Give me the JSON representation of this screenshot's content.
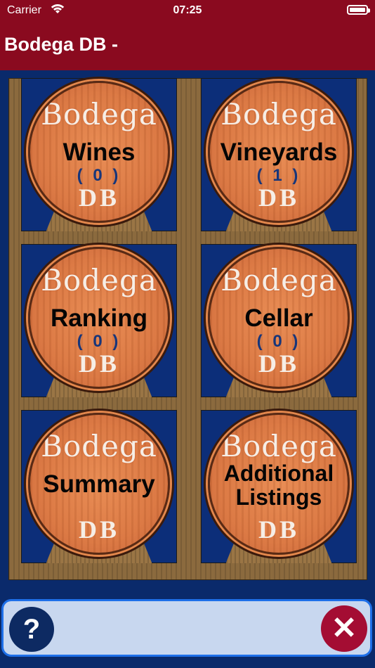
{
  "status_bar": {
    "carrier": "Carrier",
    "time": "07:25",
    "wifi_icon": "wifi-icon",
    "battery_icon": "battery-icon"
  },
  "nav": {
    "title": "Bodega DB -"
  },
  "barrel_branding": {
    "top_text": "Bodega",
    "bottom_text": "DB"
  },
  "tiles": [
    {
      "label": "Wines",
      "count": "( 0 )"
    },
    {
      "label": "Vineyards",
      "count": "( 1 )"
    },
    {
      "label": "Ranking",
      "count": "( 0 )"
    },
    {
      "label": "Cellar",
      "count": "( 0 )"
    },
    {
      "label": "Summary",
      "count": ""
    },
    {
      "label": "Additional Listings",
      "count": ""
    }
  ],
  "toolbar": {
    "help_label": "?",
    "help_icon": "help-icon",
    "close_label": "✕",
    "close_icon": "close-icon"
  },
  "colors": {
    "header": "#8a0a1f",
    "background": "#0a2a6b",
    "toolbar": "#c8d7ef",
    "toolbar_border": "#1e6fe8",
    "help_button": "#0d2a62",
    "close_button": "#a40d33"
  }
}
